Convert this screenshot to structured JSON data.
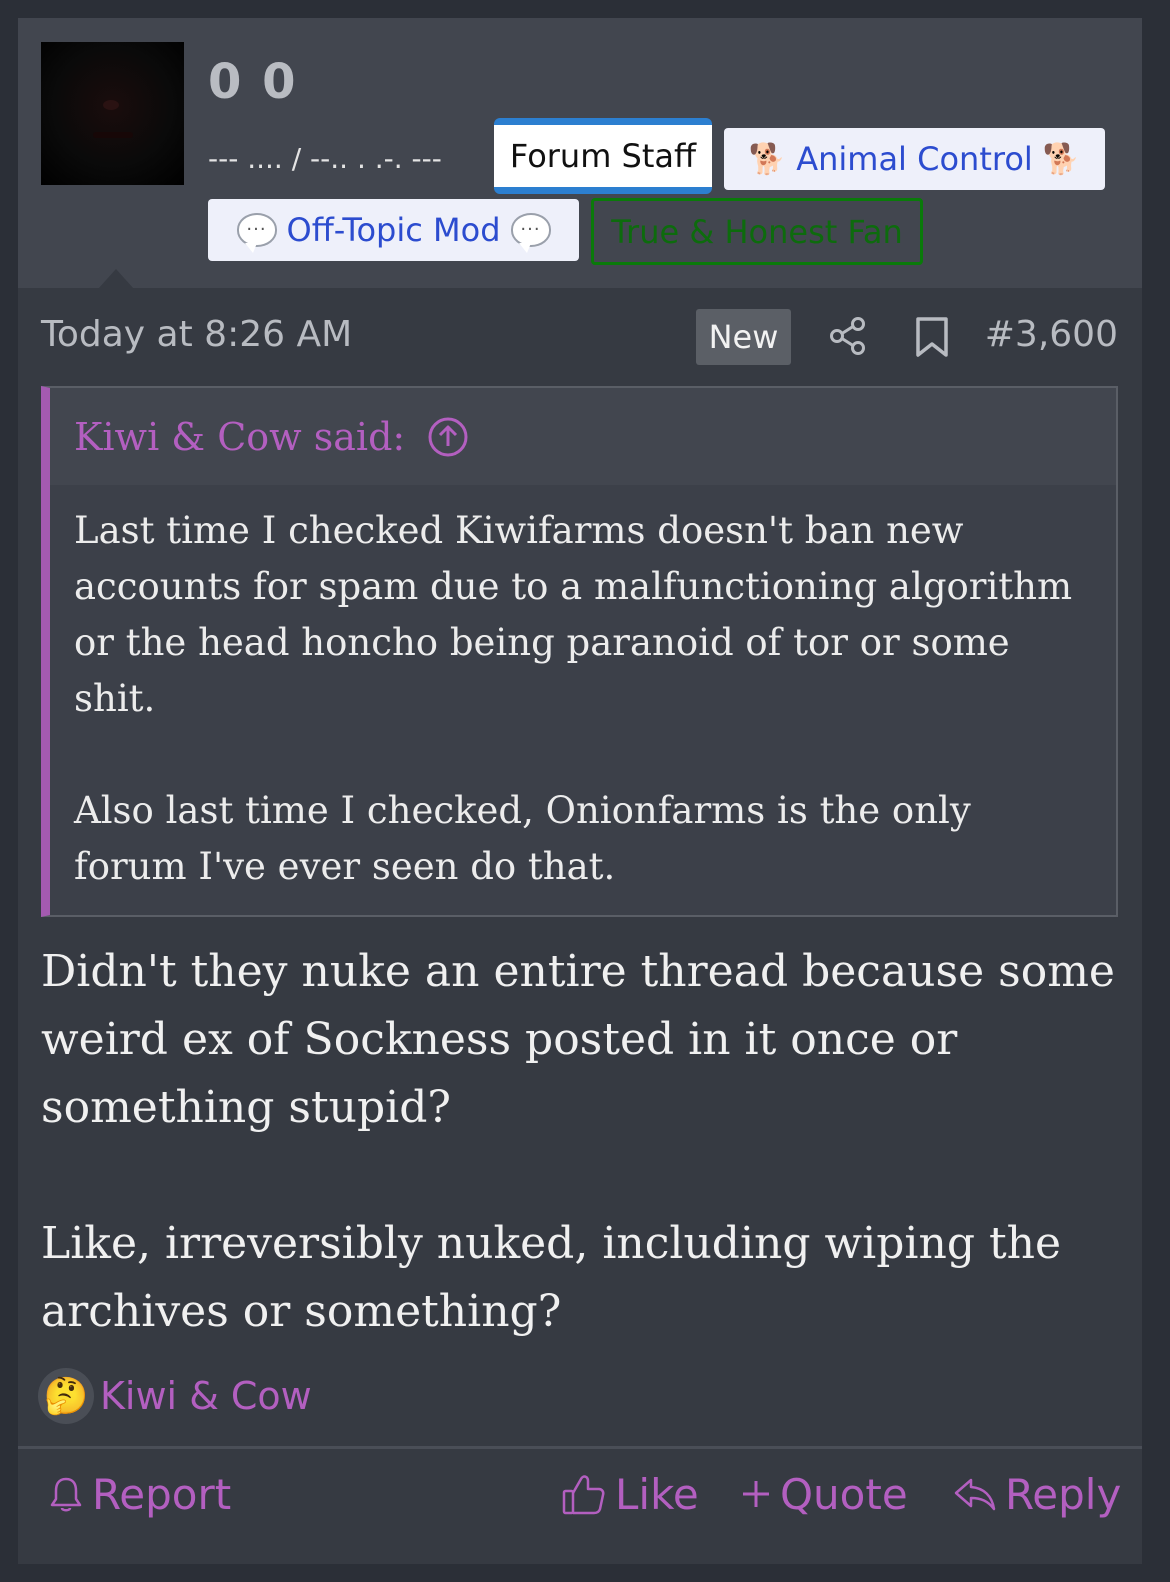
{
  "user": {
    "name": "0 0",
    "title": "--- .... / --.. . .-. ---"
  },
  "banners": {
    "forum_staff": "Forum Staff",
    "animal_control": "Animal Control",
    "animal_icon": "dog-icon",
    "offtopic_mod": "Off-Topic Mod",
    "offtopic_icon": "speech-bubble-icon",
    "fan": "True & Honest Fan"
  },
  "meta": {
    "time": "Today at 8:26 AM",
    "new_label": "New",
    "post_number": "#3,600"
  },
  "quote": {
    "attribution": "Kiwi & Cow said:",
    "paragraphs": [
      "Last time I checked Kiwifarms doesn't ban new accounts for spam due to a malfunctioning algorithm or the head honcho being paranoid of tor or some shit.",
      "Also last time I checked, Onionfarms is the only forum I've ever seen do that."
    ]
  },
  "message": {
    "paragraphs": [
      "Didn't they nuke an entire thread because some weird ex of Sockness posted in it once or something stupid?",
      "Like, irreversibly nuked, including wiping the archives or something?"
    ]
  },
  "reaction": {
    "emoji": "🤔",
    "user": "Kiwi & Cow"
  },
  "actions": {
    "report": "Report",
    "like": "Like",
    "quote": "Quote",
    "reply": "Reply"
  },
  "colors": {
    "accent": "#b35fc0",
    "staff_border": "#2c7fd0",
    "banner_text": "#2c4ccf",
    "fan_green": "#0a7a0a"
  }
}
